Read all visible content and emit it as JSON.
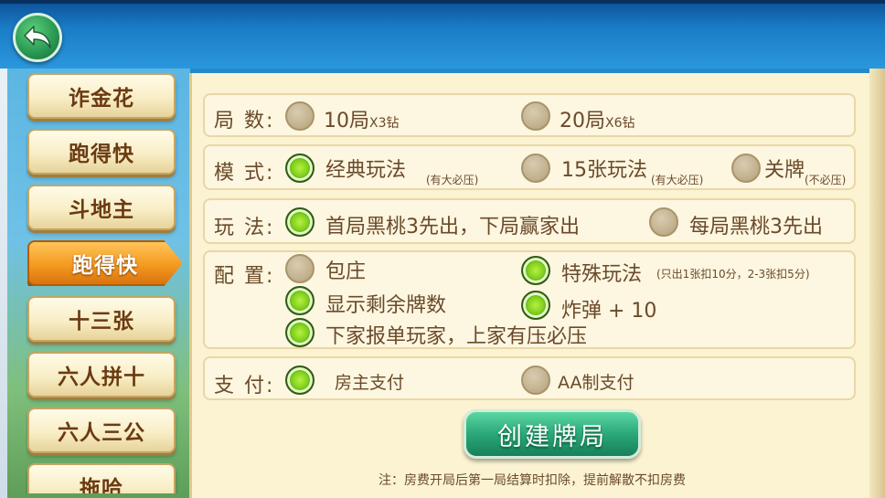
{
  "menu": {
    "items": [
      {
        "label": "诈金花"
      },
      {
        "label": "跑得快"
      },
      {
        "label": "斗地主"
      },
      {
        "label": "跑得快"
      },
      {
        "label": "十三张"
      },
      {
        "label": "六人拼十"
      },
      {
        "label": "六人三公"
      },
      {
        "label": "拖哈"
      }
    ],
    "active_index": 3
  },
  "rounds": {
    "label": "局 数:",
    "options": [
      {
        "main": "10局",
        "small": "X3钻",
        "selected": false
      },
      {
        "main": "20局",
        "small": "X6钻",
        "selected": false
      }
    ]
  },
  "mode": {
    "label": "模 式:",
    "options": [
      {
        "main": "经典玩法",
        "note": "(有大必压)",
        "selected": true
      },
      {
        "main": "15张玩法",
        "note": "(有大必压)",
        "selected": false
      },
      {
        "main": "关牌",
        "note": "(不必压)",
        "selected": false
      }
    ]
  },
  "play": {
    "label": "玩 法:",
    "options": [
      {
        "main": "首局黑桃3先出，下局赢家出",
        "selected": true
      },
      {
        "main": "每局黑桃3先出",
        "selected": false
      }
    ]
  },
  "config": {
    "label": "配 置:",
    "options": [
      {
        "main": "包庄",
        "selected": false
      },
      {
        "main": "特殊玩法",
        "note": "(只出1张扣10分，2-3张扣5分)",
        "selected": true
      },
      {
        "main": "显示剩余牌数",
        "selected": true
      },
      {
        "main": "炸弹 + 10",
        "selected": true
      },
      {
        "main": "下家报单玩家，上家有压必压",
        "selected": true
      }
    ]
  },
  "payment": {
    "label": "支 付:",
    "options": [
      {
        "main": "房主支付",
        "selected": true
      },
      {
        "main": "AA制支付",
        "selected": false
      }
    ]
  },
  "create_button": "创建牌局",
  "note": "注：房费开局后第一局结算时扣除，提前解散不扣房费",
  "colors": {
    "panel_bg": "#fbf3d2",
    "text": "#6a4a2a",
    "selected_radio": "#7fcf1c",
    "active_tab": "#f39a20",
    "create_button": "#2aa878"
  }
}
